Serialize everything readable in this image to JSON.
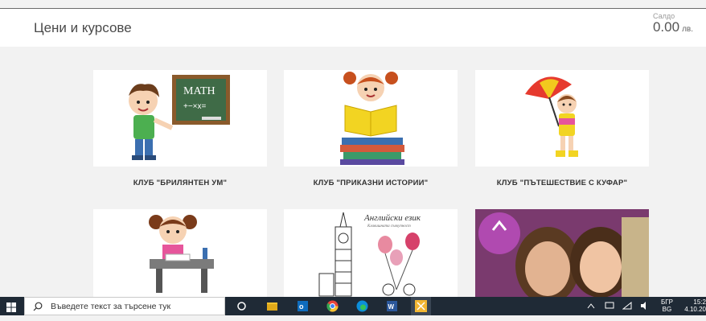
{
  "header": {
    "title": "Цени и курсове",
    "balance_label": "Салдо",
    "balance_value": "0.00",
    "balance_currency": "лв."
  },
  "cards": [
    {
      "title": "КЛУБ \"БРИЛЯНТЕН УМ\"",
      "image_icon": "math-boy-chalkboard"
    },
    {
      "title": "КЛУБ \"ПРИКАЗНИ ИСТОРИИ\"",
      "image_icon": "girl-reading-books"
    },
    {
      "title": "КЛУБ \"ПЪТЕШЕСТВИЕ С КУФАР\"",
      "image_icon": "girl-umbrella"
    },
    {
      "title": "",
      "image_icon": "girl-studying-desk"
    },
    {
      "title": "",
      "image_icon": "big-ben-english",
      "overlay_text": "Английски език",
      "overlay_subtext": "Клавишната съвкупност"
    },
    {
      "title": "",
      "image_icon": "two-girls-photo"
    }
  ],
  "taskbar": {
    "search_placeholder": "Въведете текст за търсене тук",
    "lang_top": "БГР",
    "lang_bottom": "BG",
    "time": "15:2",
    "date": "4.10.20"
  },
  "colors": {
    "accent_blue": "#0078d7",
    "taskbar_bg": "#1f2a36",
    "page_bg": "#f2f2f2"
  }
}
